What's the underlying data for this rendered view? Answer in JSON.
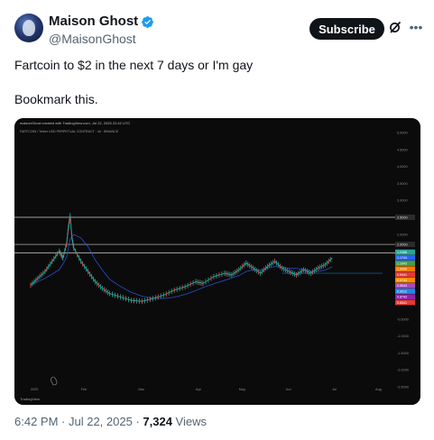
{
  "tweet": {
    "author": {
      "display_name": "Maison Ghost",
      "handle": "@MaisonGhost",
      "verified": true
    },
    "subscribe_label": "Subscribe",
    "more_label": "•••",
    "text_lines": [
      "Fartcoin to $2 in the next 7 days or I'm gay",
      "Bookmark this."
    ],
    "meta": {
      "time": "6:42 PM",
      "separator": " · ",
      "date": "Jul 22, 2025",
      "views_count": "7,324",
      "views_label": " Views"
    }
  },
  "chart_data": {
    "type": "line",
    "header_caption": "maisonGhost created with TradingView.com, Jul 22, 2025 22:42 UTC",
    "symbol_line": "FARTCOIN / Tether USD PERPETUAL CONTRACT · 4h · BINANCE",
    "x_labels": [
      "2025",
      "Feb",
      "Mar",
      "Apr",
      "May",
      "Jun",
      "Jul",
      "Aug"
    ],
    "y_labels": [
      "5.0000",
      "4.5000",
      "4.0000",
      "3.5000",
      "3.0000",
      "2.5000",
      "2.0000",
      "1.5000",
      "1.0000",
      "0.5000",
      "0.0000",
      "-0.5000",
      "-1.0000",
      "-1.5000",
      "-2.0000",
      "-2.5000"
    ],
    "horizontal_levels": [
      {
        "value": 2.5,
        "label": "2.5000"
      },
      {
        "value": 1.7,
        "label": "2.0000"
      },
      {
        "value": 1.45,
        "label": "1.2488"
      }
    ],
    "price_path": [
      [
        0.02,
        0.5
      ],
      [
        0.04,
        0.7
      ],
      [
        0.06,
        0.9
      ],
      [
        0.08,
        1.2
      ],
      [
        0.1,
        1.5
      ],
      [
        0.11,
        1.3
      ],
      [
        0.12,
        1.7
      ],
      [
        0.125,
        2.2
      ],
      [
        0.13,
        2.55
      ],
      [
        0.135,
        1.9
      ],
      [
        0.14,
        1.6
      ],
      [
        0.16,
        1.2
      ],
      [
        0.18,
        0.9
      ],
      [
        0.2,
        0.6
      ],
      [
        0.22,
        0.4
      ],
      [
        0.24,
        0.25
      ],
      [
        0.27,
        0.15
      ],
      [
        0.3,
        0.05
      ],
      [
        0.33,
        0.02
      ],
      [
        0.36,
        0.1
      ],
      [
        0.39,
        0.2
      ],
      [
        0.42,
        0.35
      ],
      [
        0.45,
        0.45
      ],
      [
        0.48,
        0.6
      ],
      [
        0.5,
        0.55
      ],
      [
        0.53,
        0.75
      ],
      [
        0.56,
        0.85
      ],
      [
        0.58,
        0.8
      ],
      [
        0.6,
        0.95
      ],
      [
        0.62,
        1.15
      ],
      [
        0.64,
        1.0
      ],
      [
        0.66,
        0.85
      ],
      [
        0.68,
        1.05
      ],
      [
        0.7,
        1.2
      ],
      [
        0.72,
        1.0
      ],
      [
        0.74,
        0.9
      ],
      [
        0.76,
        0.8
      ],
      [
        0.78,
        0.95
      ],
      [
        0.8,
        0.85
      ],
      [
        0.82,
        1.0
      ],
      [
        0.84,
        1.1
      ],
      [
        0.86,
        1.3
      ]
    ],
    "price_markers": [
      {
        "label": "1.2488",
        "color": "#26a69a"
      },
      {
        "label": "1.1744",
        "color": "#2962ff"
      },
      {
        "label": "1.1643",
        "color": "#43a047"
      },
      {
        "label": "1.0940",
        "color": "#f57c00"
      },
      {
        "label": "0.9941",
        "color": "#e53935"
      },
      {
        "label": "0.9744",
        "color": "#fb8c00"
      },
      {
        "label": "0.9543",
        "color": "#ab47bc"
      },
      {
        "label": "0.9012",
        "color": "#1e88e5"
      },
      {
        "label": "0.8743",
        "color": "#8e24aa"
      },
      {
        "label": "0.8541",
        "color": "#e53935"
      }
    ],
    "watermark": "TradingView",
    "colors": {
      "background": "#0b0b0b",
      "line": "#26a69a",
      "level": "#cfcfcf",
      "grid": "#1a1a1a"
    }
  }
}
